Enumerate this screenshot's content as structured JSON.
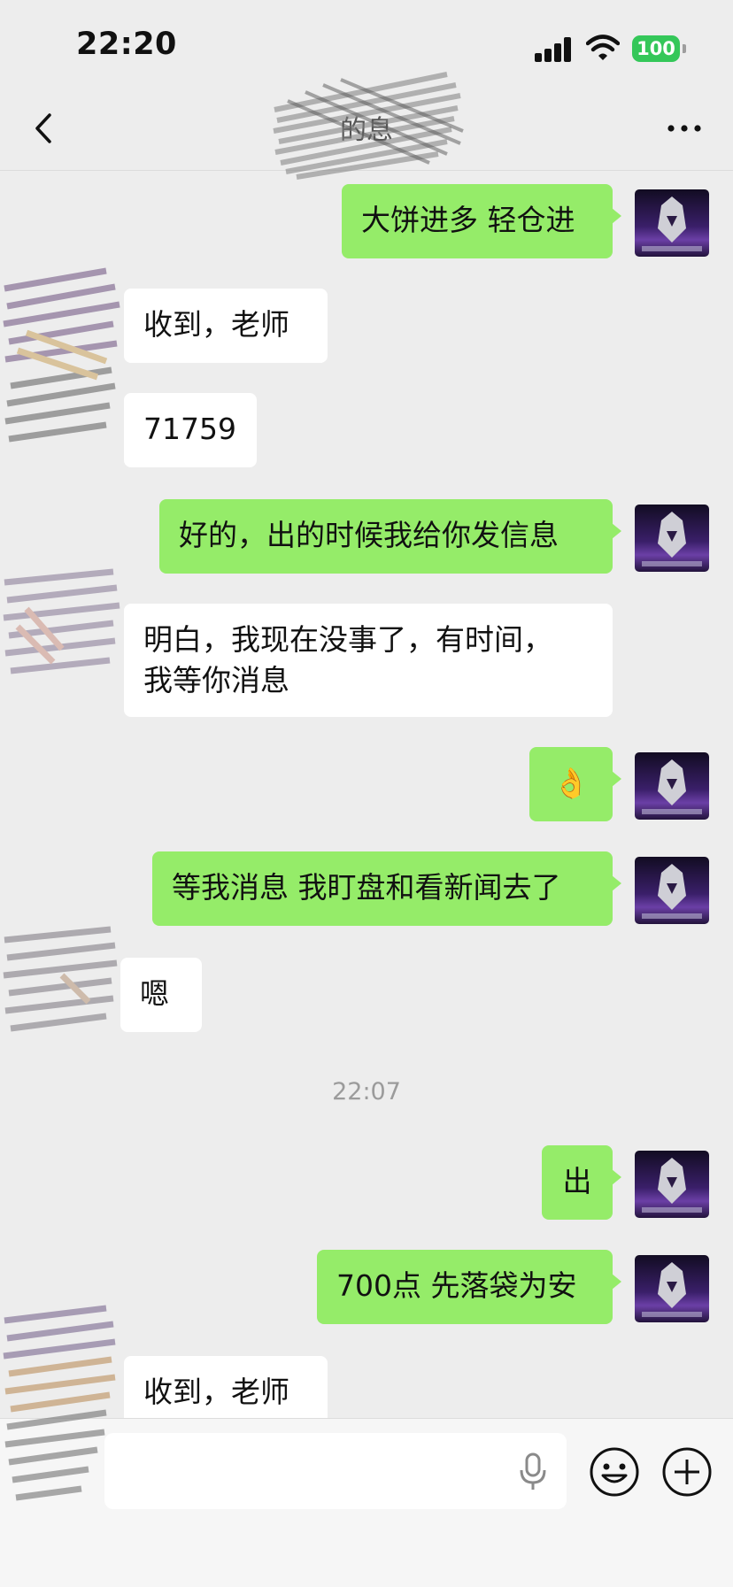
{
  "status_bar": {
    "time": "22:20",
    "battery": "100"
  },
  "header": {
    "title": "的息"
  },
  "messages": [
    {
      "side": "right",
      "text": "大饼进多 轻仓进"
    },
    {
      "side": "left",
      "text": "收到，老师"
    },
    {
      "side": "left",
      "text": "71759"
    },
    {
      "side": "right",
      "text": "好的，出的时候我给你发信息"
    },
    {
      "side": "left",
      "text": "明白，我现在没事了，有时间，\n我等你消息"
    },
    {
      "side": "right",
      "text": "👌"
    },
    {
      "side": "right",
      "text": "等我消息 我盯盘和看新闻去了"
    },
    {
      "side": "left",
      "text": "嗯"
    },
    {
      "type": "timestamp",
      "text": "22:07"
    },
    {
      "side": "right",
      "text": "出"
    },
    {
      "side": "right",
      "text": "700点 先落袋为安"
    },
    {
      "side": "left",
      "text": "收到，老师"
    }
  ],
  "colors": {
    "background": "#ededed",
    "sent_bubble": "#95ec69",
    "received_bubble": "#ffffff",
    "battery": "#34c759"
  },
  "icons": {
    "back": "chevron-left-icon",
    "more": "more-dots-icon",
    "mic": "microphone-icon",
    "emoji": "smiley-icon",
    "plus": "plus-circle-icon"
  }
}
